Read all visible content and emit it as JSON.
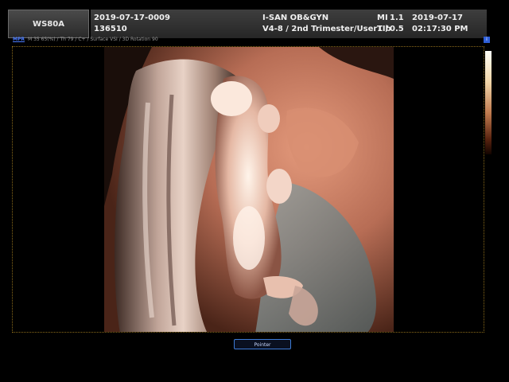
{
  "header": {
    "model": "WS80A",
    "exam_id": "2019-07-17-0009",
    "patient_id": "136510",
    "institution": "I-SAN OB&GYN",
    "probe_preset": "V4-8 / 2nd Trimester/User1 /",
    "mi_label": "MI",
    "mi_value": "1.1",
    "tib_label": "TIb",
    "tib_value": "0.5",
    "date": "2019-07-17",
    "time": "02:17:30 PM"
  },
  "subheader": {
    "mode": "MPR",
    "params": "M 35 65(%) / Th 79 / C+ / Surface VSI / 3D Rotation 90"
  },
  "corner_icon": "info-icon",
  "colors": {
    "accent_blue": "#3d7bd6",
    "frame": "#8a6a1a",
    "tissue": "#c07a5e"
  },
  "bottom": {
    "pointer_label": "Pointer"
  }
}
